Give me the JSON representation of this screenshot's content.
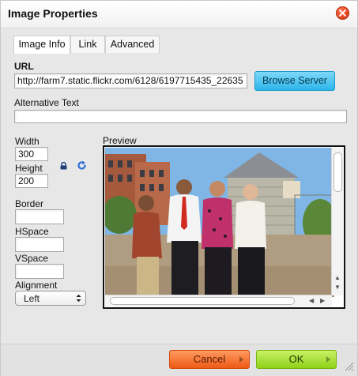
{
  "dialog": {
    "title": "Image Properties"
  },
  "tabs": [
    {
      "label": "Image Info",
      "active": true
    },
    {
      "label": "Link",
      "active": false
    },
    {
      "label": "Advanced",
      "active": false
    }
  ],
  "url": {
    "label": "URL",
    "value": "http://farm7.static.flickr.com/6128/6197715435_22635",
    "browse_label": "Browse Server"
  },
  "alt_text": {
    "label": "Alternative Text",
    "value": ""
  },
  "dimensions": {
    "width_label": "Width",
    "width_value": "300",
    "height_label": "Height",
    "height_value": "200",
    "lock_icon": "lock-icon",
    "reset_icon": "reset-size-icon"
  },
  "border": {
    "label": "Border",
    "value": ""
  },
  "hspace": {
    "label": "HSpace",
    "value": ""
  },
  "vspace": {
    "label": "VSpace",
    "value": ""
  },
  "alignment": {
    "label": "Alignment",
    "selected": "Left"
  },
  "preview": {
    "label": "Preview"
  },
  "buttons": {
    "cancel": "Cancel",
    "ok": "OK"
  },
  "colors": {
    "browse": "#2bb5ea",
    "cancel": "#ee5a16",
    "ok": "#8fd118",
    "close": "#e0401c"
  }
}
